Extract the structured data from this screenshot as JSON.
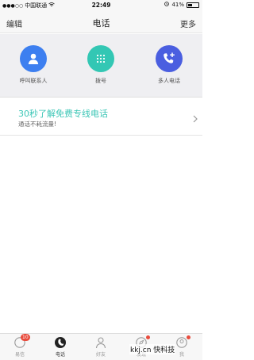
{
  "status_bar": {
    "carrier": "中国联通",
    "time": "22:49",
    "battery": "41%",
    "battery_level": 0.41
  },
  "nav": {
    "left": "编辑",
    "title": "电话",
    "right": "更多"
  },
  "actions": [
    {
      "label": "呼叫联系人",
      "icon": "contact-icon",
      "color": "#3d7ff0"
    },
    {
      "label": "拨号",
      "icon": "dialpad-icon",
      "color": "#33c7b4"
    },
    {
      "label": "多人电话",
      "icon": "conference-call-icon",
      "color": "#4a5ee0"
    }
  ],
  "promo": {
    "title": "30秒了解免费专线电话",
    "subtitle": "通话不耗流量!"
  },
  "tabs": [
    {
      "label": "易信",
      "icon": "message-icon",
      "badge": "10"
    },
    {
      "label": "电话",
      "icon": "phone-icon",
      "active": true
    },
    {
      "label": "好友",
      "icon": "friends-icon"
    },
    {
      "label": "发现",
      "icon": "discover-icon",
      "dot": true
    },
    {
      "label": "我",
      "icon": "me-icon",
      "dot": true
    }
  ],
  "watermark": "kkj.cn 快科技",
  "colors": {
    "accent": "#3cc6b6",
    "badge": "#e84c3d"
  }
}
